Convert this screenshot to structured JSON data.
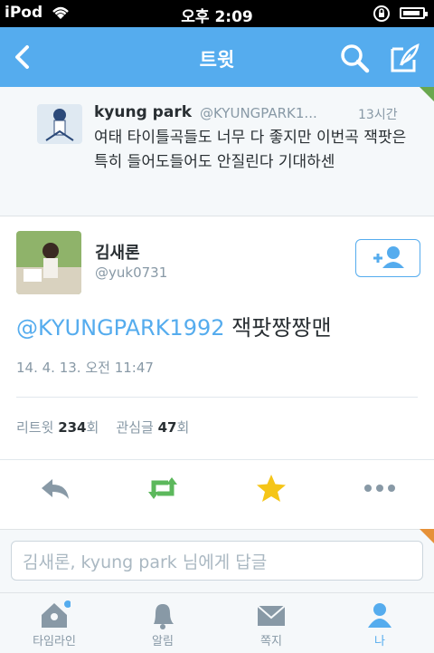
{
  "status_bar": {
    "carrier": "iPod",
    "time": "오후 2:09"
  },
  "nav": {
    "title": "트윗"
  },
  "parent_tweet": {
    "name": "kyung park",
    "handle": "@KYUNGPARK1...",
    "time": "13시간",
    "text": "여태 타이틀곡들도 너무 다 좋지만 이번곡 잭팟은 특히 들어도들어도 안질린다 기대하센"
  },
  "main_tweet": {
    "name": "김새론",
    "handle": "@yuk0731",
    "mention": "@KYUNGPARK1992",
    "text": "잭팟짱짱맨",
    "date": "14. 4. 13. 오전 11:47",
    "retweets_label": "리트윗",
    "retweets_count": "234",
    "retweets_unit": "회",
    "favorites_label": "관심글",
    "favorites_count": "47",
    "favorites_unit": "회"
  },
  "reply": {
    "placeholder": "김새론, kyung park 님에게 답글"
  },
  "tabs": [
    {
      "label": "타임라인",
      "icon": "home-icon"
    },
    {
      "label": "알림",
      "icon": "bell-icon"
    },
    {
      "label": "쪽지",
      "icon": "envelope-icon"
    },
    {
      "label": "나",
      "icon": "person-icon"
    }
  ],
  "colors": {
    "accent": "#55acee",
    "retweet": "#5cb85c",
    "favorite": "#f5c518",
    "text": "#292f33",
    "muted": "#8899a6"
  }
}
